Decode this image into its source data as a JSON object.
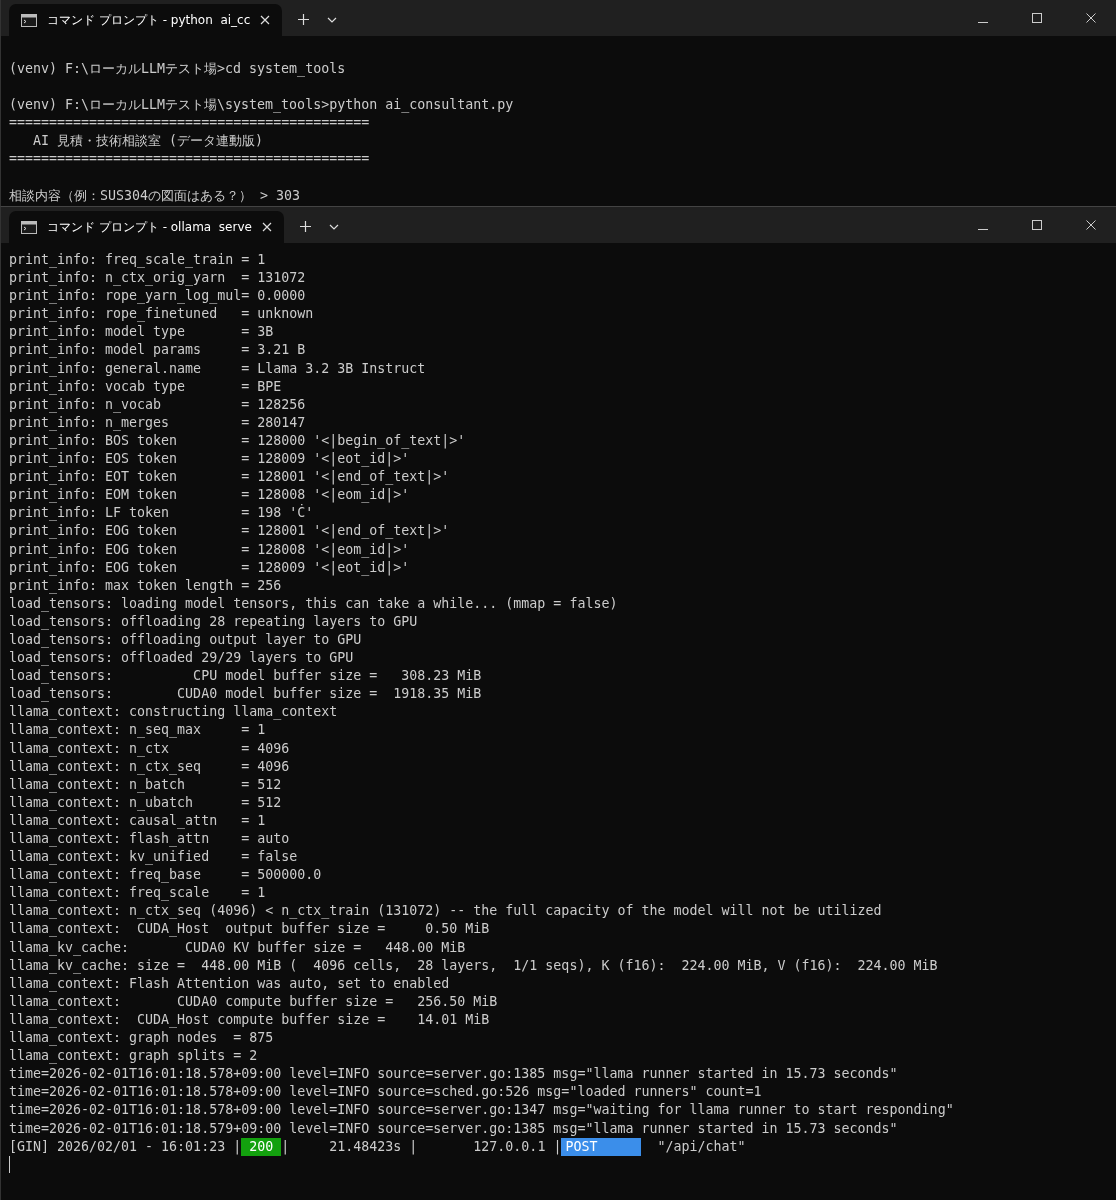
{
  "windows": [
    {
      "tab": {
        "title": "コマンド プロンプト - python  ai_cc",
        "selected": true
      },
      "blocks": [
        [
          "(venv) F:\\ローカルLLMテスト場>cd system_tools"
        ],
        [
          "(venv) F:\\ローカルLLMテスト場\\system_tools>python ai_consultant.py",
          "=============================================",
          "   AI 見積・技術相談室 (データ連動版)",
          "============================================="
        ],
        [
          "相談内容（例：SUS304の図面はある？） > 303"
        ]
      ]
    },
    {
      "tab": {
        "title": "コマンド プロンプト - ollama  serve",
        "selected": true
      },
      "blocks": [
        [
          "print_info: freq_scale_train = 1",
          "print_info: n_ctx_orig_yarn  = 131072",
          "print_info: rope_yarn_log_mul= 0.0000",
          "print_info: rope_finetuned   = unknown",
          "print_info: model type       = 3B",
          "print_info: model params     = 3.21 B",
          "print_info: general.name     = Llama 3.2 3B Instruct",
          "print_info: vocab type       = BPE",
          "print_info: n_vocab          = 128256",
          "print_info: n_merges         = 280147",
          "print_info: BOS token        = 128000 '<|begin_of_text|>'",
          "print_info: EOS token        = 128009 '<|eot_id|>'",
          "print_info: EOT token        = 128001 '<|end_of_text|>'",
          "print_info: EOM token        = 128008 '<|eom_id|>'",
          "print_info: LF token         = 198 'Ċ'",
          "print_info: EOG token        = 128001 '<|end_of_text|>'",
          "print_info: EOG token        = 128008 '<|eom_id|>'",
          "print_info: EOG token        = 128009 '<|eot_id|>'",
          "print_info: max token length = 256",
          "load_tensors: loading model tensors, this can take a while... (mmap = false)",
          "load_tensors: offloading 28 repeating layers to GPU",
          "load_tensors: offloading output layer to GPU",
          "load_tensors: offloaded 29/29 layers to GPU",
          "load_tensors:          CPU model buffer size =   308.23 MiB",
          "load_tensors:        CUDA0 model buffer size =  1918.35 MiB",
          "llama_context: constructing llama_context",
          "llama_context: n_seq_max     = 1",
          "llama_context: n_ctx         = 4096",
          "llama_context: n_ctx_seq     = 4096",
          "llama_context: n_batch       = 512",
          "llama_context: n_ubatch      = 512",
          "llama_context: causal_attn   = 1",
          "llama_context: flash_attn    = auto",
          "llama_context: kv_unified    = false",
          "llama_context: freq_base     = 500000.0",
          "llama_context: freq_scale    = 1",
          "llama_context: n_ctx_seq (4096) < n_ctx_train (131072) -- the full capacity of the model will not be utilized",
          "llama_context:  CUDA_Host  output buffer size =     0.50 MiB",
          "llama_kv_cache:       CUDA0 KV buffer size =   448.00 MiB",
          "llama_kv_cache: size =  448.00 MiB (  4096 cells,  28 layers,  1/1 seqs), K (f16):  224.00 MiB, V (f16):  224.00 MiB",
          "llama_context: Flash Attention was auto, set to enabled",
          "llama_context:       CUDA0 compute buffer size =   256.50 MiB",
          "llama_context:  CUDA_Host compute buffer size =    14.01 MiB",
          "llama_context: graph nodes  = 875",
          "llama_context: graph splits = 2",
          "time=2026-02-01T16:01:18.578+09:00 level=INFO source=server.go:1385 msg=\"llama runner started in 15.73 seconds\"",
          "time=2026-02-01T16:01:18.578+09:00 level=INFO source=sched.go:526 msg=\"loaded runners\" count=1",
          "time=2026-02-01T16:01:18.578+09:00 level=INFO source=server.go:1347 msg=\"waiting for llama runner to start responding\"",
          "time=2026-02-01T16:01:18.579+09:00 level=INFO source=server.go:1385 msg=\"llama runner started in 15.73 seconds\""
        ]
      ],
      "segments": [
        {
          "kind": "text",
          "text": "[GIN] 2026/02/01 - 16:01:23 |"
        },
        {
          "kind": "status",
          "text": "200"
        },
        {
          "kind": "text",
          "text": "|     21.48423s |       127.0.0.1 |"
        },
        {
          "kind": "method",
          "text": "POST"
        },
        {
          "kind": "text",
          "text": "  \"/api/chat\""
        }
      ],
      "cursor": true
    }
  ]
}
